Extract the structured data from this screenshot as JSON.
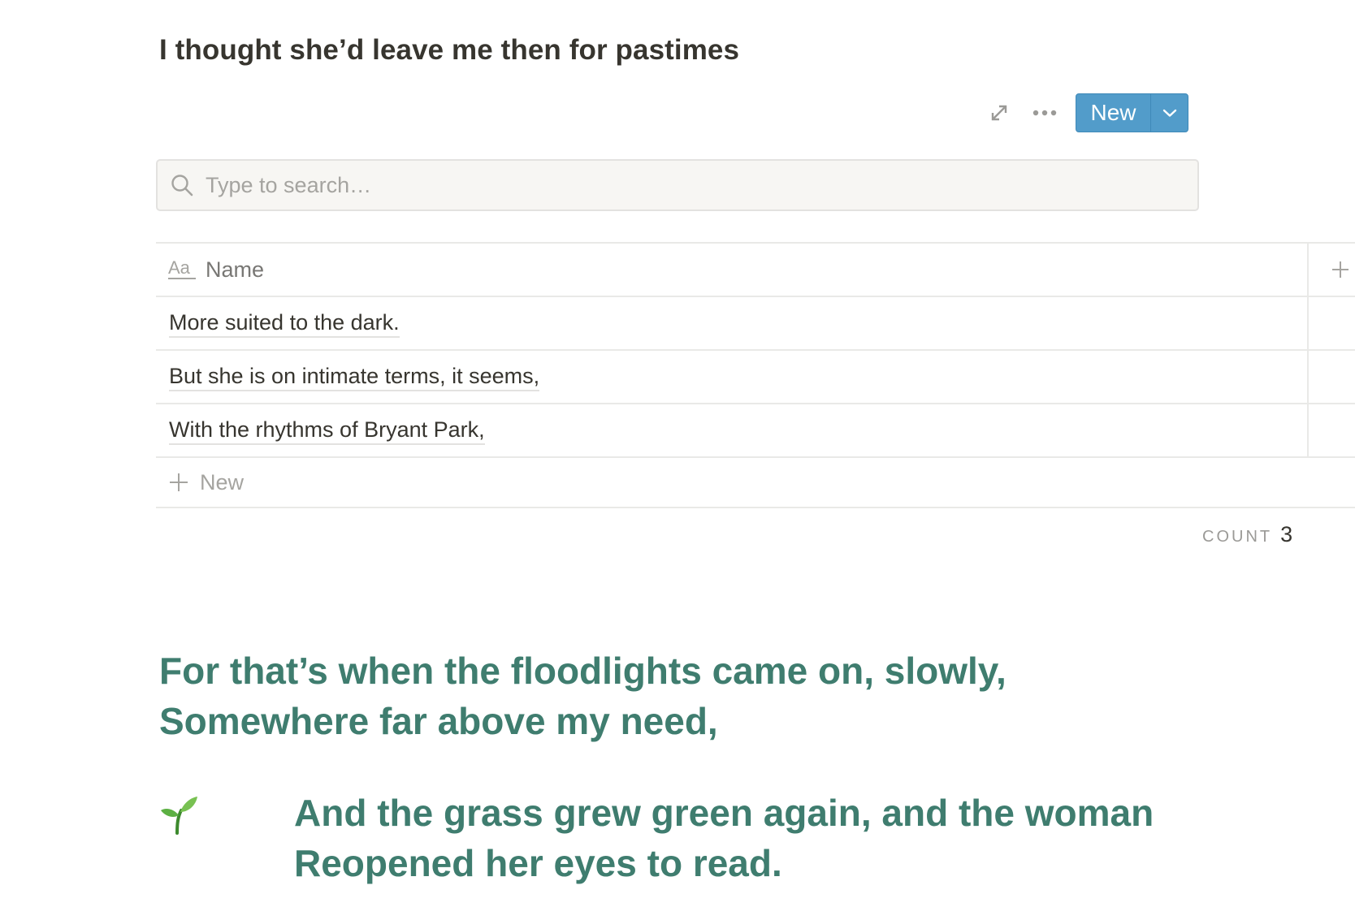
{
  "database": {
    "title": "I thought she’d leave me then for pastimes"
  },
  "toolbar": {
    "expand_icon": "expand-icon",
    "more_icon": "ellipsis-icon",
    "new_label": "New",
    "new_dropdown_icon": "chevron-down-icon",
    "accent_color": "#529cca"
  },
  "search": {
    "placeholder": "Type to search…",
    "value": ""
  },
  "table": {
    "columns": [
      {
        "label": "Name",
        "icon": "text-property-icon"
      }
    ],
    "rows": [
      {
        "name": "More suited to the dark."
      },
      {
        "name": "But she is on intimate terms, it seems,"
      },
      {
        "name": "With the rhythms of Bryant Park,"
      }
    ],
    "new_row_label": "New",
    "count_label": "COUNT",
    "count_value": "3"
  },
  "heading": {
    "line1": "For that’s when the floodlights came on, slowly,",
    "line2": "Somewhere far above my need,",
    "color": "#3f7d6f"
  },
  "callout": {
    "emoji": "seedling-icon",
    "line1": "And the grass grew green again, and the woman",
    "line2": "Reopened her eyes to read."
  }
}
